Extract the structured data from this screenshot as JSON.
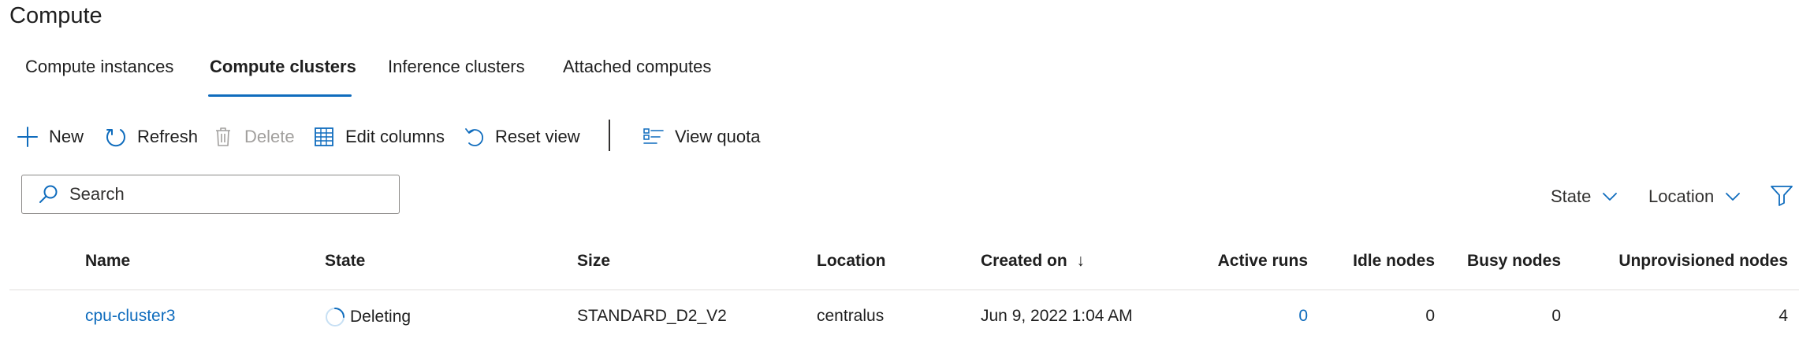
{
  "page": {
    "title": "Compute"
  },
  "tabs": [
    {
      "label": "Compute instances",
      "active": false
    },
    {
      "label": "Compute clusters",
      "active": true
    },
    {
      "label": "Inference clusters",
      "active": false
    },
    {
      "label": "Attached computes",
      "active": false
    }
  ],
  "toolbar": {
    "new_label": "New",
    "refresh_label": "Refresh",
    "delete_label": "Delete",
    "edit_columns_label": "Edit columns",
    "reset_view_label": "Reset view",
    "view_quota_label": "View quota"
  },
  "search": {
    "placeholder": "Search",
    "value": ""
  },
  "filters": {
    "state_label": "State",
    "location_label": "Location"
  },
  "table": {
    "columns": {
      "name": "Name",
      "state": "State",
      "size": "Size",
      "location": "Location",
      "created_on": "Created on",
      "active_runs": "Active runs",
      "idle_nodes": "Idle nodes",
      "busy_nodes": "Busy nodes",
      "unprovisioned_nodes": "Unprovisioned nodes"
    },
    "sort": {
      "column": "created_on",
      "direction": "descending",
      "indicator": "↓"
    },
    "rows": [
      {
        "name": "cpu-cluster3",
        "state": "Deleting",
        "size": "STANDARD_D2_V2",
        "location": "centralus",
        "created_on": "Jun 9, 2022 1:04 AM",
        "active_runs": "0",
        "idle_nodes": "0",
        "busy_nodes": "0",
        "unprovisioned_nodes": "4"
      }
    ]
  },
  "colors": {
    "accent": "#0f6cbd",
    "text": "#1f1f1f",
    "disabled": "#a19f9d",
    "border": "#8a8886"
  },
  "icons": {
    "new": "plus-icon",
    "refresh": "refresh-icon",
    "delete": "trash-icon",
    "edit_columns": "table-grid-icon",
    "reset_view": "reset-arrow-icon",
    "view_quota": "list-quota-icon",
    "search": "search-icon",
    "filter": "funnel-icon",
    "dropdown": "chevron-down-icon",
    "state_deleting": "spinner-icon"
  }
}
